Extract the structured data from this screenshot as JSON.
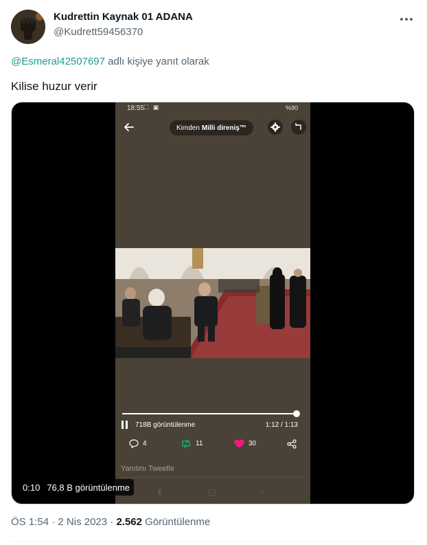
{
  "author": {
    "display_name": "Kudrettin Kaynak 01 ADANA",
    "handle": "@Kudrett59456370",
    "avatar_icon": "fist-avatar"
  },
  "reply": {
    "mention": "@Esmeral42507697",
    "suffix": "adlı kişiye yanıt olarak"
  },
  "tweet_text": "Kilise huzur verir",
  "video": {
    "status_time": "18:55",
    "status_battery": "%90",
    "pill_prefix": "Kimden",
    "pill_name": "Milli direniş™",
    "views_inner": "718B görüntülenme",
    "duration": "1:12 / 1:13",
    "progress": 0.986,
    "replies": "4",
    "retweets": "11",
    "likes": "30",
    "reply_placeholder": "Yanıtını Tweetle",
    "overlay_time": "0:10",
    "overlay_views": "76,8 B görüntülenme",
    "colors": {
      "retweet": "#00ba7c",
      "like": "#f91880",
      "phone_bg": "#4a4236"
    }
  },
  "footer": {
    "time": "ÖS 1:54",
    "date": "2 Nis 2023",
    "dot": "·",
    "views_count": "2.562",
    "views_label": "Görüntülenme"
  },
  "colors": {
    "mention": "#1a9e8f",
    "secondary_text": "#536471"
  }
}
